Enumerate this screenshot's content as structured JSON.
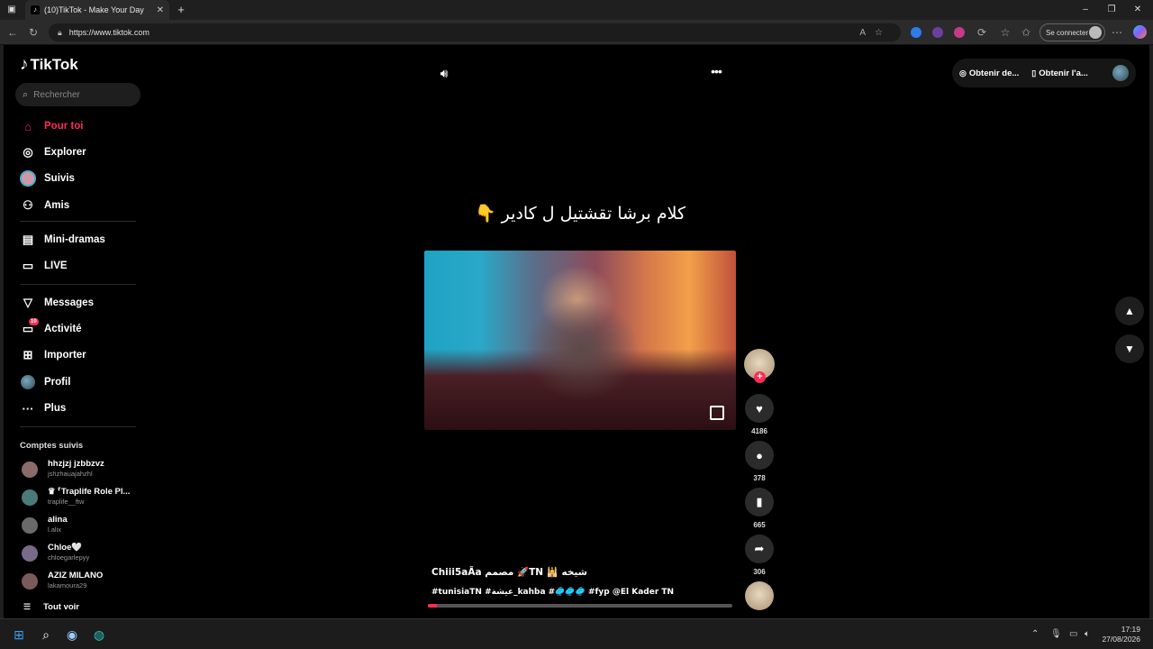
{
  "browser": {
    "tab_title": "(10)TikTok - Make Your Day",
    "url": "https://www.tiktok.com",
    "connect_label": "Se connecter"
  },
  "app": {
    "logo": "TikTok",
    "search_placeholder": "Rechercher"
  },
  "sidebar": {
    "items": [
      {
        "label": "Pour toi",
        "icon": "home-icon"
      },
      {
        "label": "Explorer",
        "icon": "compass-icon"
      },
      {
        "label": "Suivis",
        "icon": "following-avatar-icon"
      },
      {
        "label": "Amis",
        "icon": "friends-icon"
      },
      {
        "label": "Mini-dramas",
        "icon": "film-icon"
      },
      {
        "label": "LIVE",
        "icon": "live-tv-icon"
      },
      {
        "label": "Messages",
        "icon": "send-icon"
      },
      {
        "label": "Activité",
        "icon": "inbox-icon"
      },
      {
        "label": "Importer",
        "icon": "upload-plus-icon"
      },
      {
        "label": "Profil",
        "icon": "profile-avatar-icon"
      },
      {
        "label": "Plus",
        "icon": "more-dots-icon"
      }
    ],
    "activity_badge": "10",
    "followed_title": "Comptes suivis",
    "followed": [
      {
        "name": "hhzjzj jzbbzvz",
        "user": "jshzhauajahzhl"
      },
      {
        "name": "♛ ⸢Traplife Role Pl...",
        "user": "traplife__ftw"
      },
      {
        "name": "alina",
        "user": "l.alix"
      },
      {
        "name": "Chloe🤍",
        "user": "chloegarlepyy"
      },
      {
        "name": "AZIZ MILANO",
        "user": "lakamoura29"
      }
    ],
    "see_all": "Tout voir"
  },
  "topbar": {
    "get_coins": "Obtenir de...",
    "get_app": "Obtenir l'a..."
  },
  "video": {
    "caption": "كلام برشا تقشتيل ل كادير 👇",
    "author": "Chiii5aÃa مصمم 🚀TN 🕌 شيخه",
    "tags": "#tunisiaTN #عيشة_kahba #🥏🥏🥏 #fyp @El Kader TN",
    "progress": 0.03,
    "likes": "4186",
    "comments": "378",
    "saves": "665",
    "shares": "306"
  },
  "taskbar": {
    "time": "17:19",
    "date": "27/08/2026"
  },
  "colors": {
    "accent": "#fe2c55",
    "background": "#000000"
  }
}
